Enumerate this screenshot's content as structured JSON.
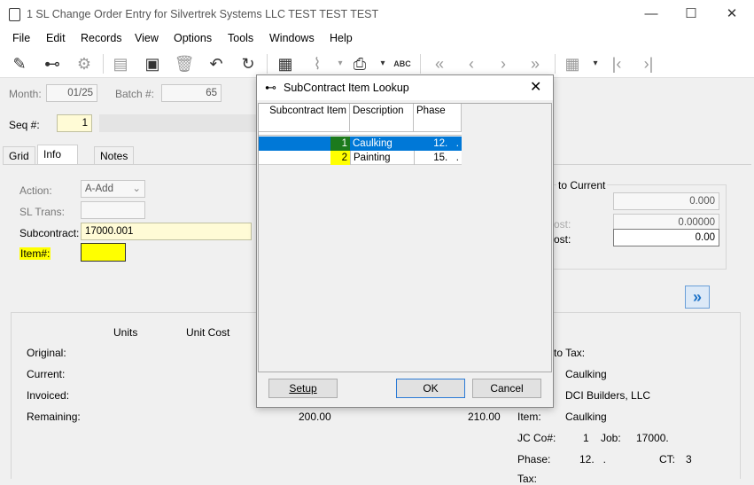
{
  "window": {
    "title": "1 SL Change Order Entry for Silvertrek Systems LLC TEST TEST TEST",
    "minimize": "—",
    "maximize": "☐",
    "close": "✕"
  },
  "menu": [
    "File",
    "Edit",
    "Records",
    "View",
    "Options",
    "Tools",
    "Windows",
    "Help"
  ],
  "toolbar": {
    "icons": [
      "edit-icon",
      "binoculars-icon",
      "gear-icon",
      "document-icon",
      "save-icon",
      "delete-icon",
      "undo-icon",
      "refresh-icon",
      "calculator-icon",
      "attach-icon",
      "print-icon",
      "spellcheck-icon",
      "first-record-icon",
      "prev-record-icon",
      "next-record-icon",
      "last-record-icon",
      "grid-settings-icon",
      "first-icon",
      "last-icon"
    ],
    "spell_label": "ABC"
  },
  "header": {
    "month_label": "Month:",
    "month_value": "01/25",
    "batch_label": "Batch #:",
    "batch_value": "65",
    "seq_label": "Seq #:",
    "seq_value": "1"
  },
  "tabs": [
    "Grid",
    "Info",
    "Notes"
  ],
  "form": {
    "action_label": "Action:",
    "action_value": "A-Add",
    "sltrans_label": "SL Trans:",
    "subcontract_label": "Subcontract:",
    "subcontract_value": "17000.001",
    "item_label": "Item#:",
    "to_current_label": "to Current",
    "current_value": "0.000",
    "ost_label_1": "ost:",
    "ost_value_1": "0.00000",
    "ost_label_2": "ost:",
    "ost_value_2": "0.00"
  },
  "summary": {
    "units_header": "Units",
    "unit_cost_header": "Unit Cost",
    "original_label": "Original:",
    "current_label": "Current:",
    "invoiced_label": "Invoiced:",
    "remaining_label": "Remaining:",
    "remaining_units": "200.00",
    "remaining_unit_cost": "210.00",
    "to_tax_label": "to Tax:",
    "desc_value": "Caulking",
    "vendor_value": "DCI Builders, LLC",
    "item_label": "Item:",
    "item_value": "Caulking",
    "jcco_label": "JC Co#:",
    "jcco_value": "1",
    "job_label": "Job:",
    "job_value": "17000.",
    "phase_label": "Phase:",
    "phase_value": "12.   .",
    "ct_label": "CT:",
    "ct_value": "3",
    "tax_label": "Tax:"
  },
  "lookup": {
    "title": "SubContract Item Lookup",
    "columns": [
      "Subcontract Item",
      "Description",
      "Phase"
    ],
    "rows": [
      {
        "item": "1",
        "description": "Caulking",
        "phase": "12.   ."
      },
      {
        "item": "2",
        "description": "Painting",
        "phase": "15.   ."
      }
    ],
    "setup_button": "Setup",
    "ok_button": "OK",
    "cancel_button": "Cancel"
  }
}
